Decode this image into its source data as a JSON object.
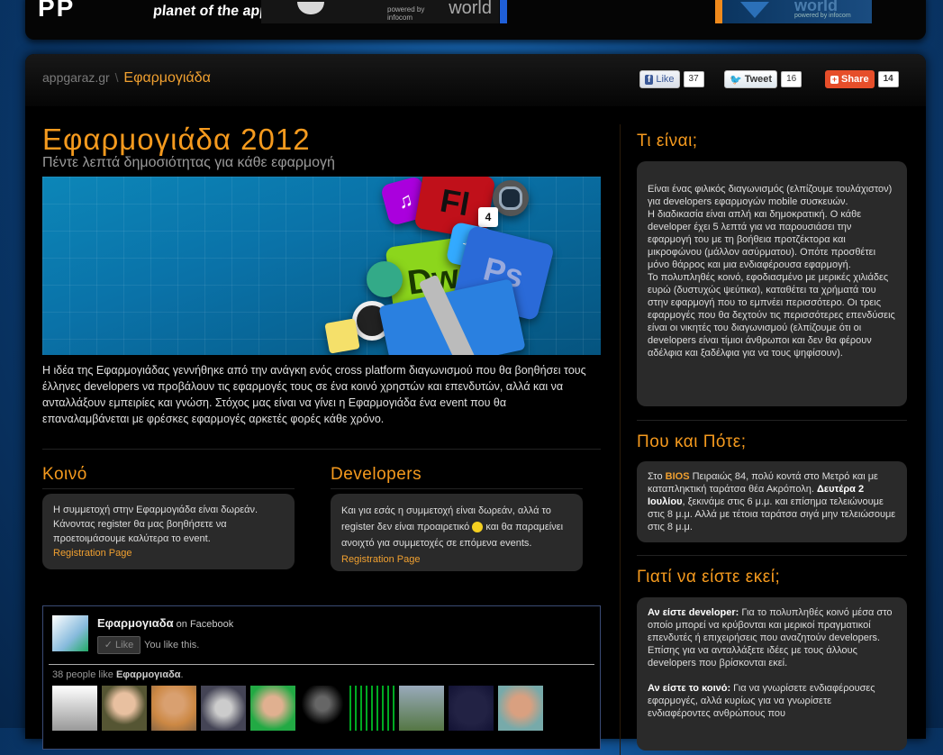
{
  "header": {
    "logo_mark": "PP",
    "logo_tagline": "planet of the apps",
    "banner1_small": "powered by\ninfocom",
    "banner1_word": "world",
    "banner2_word": "world",
    "banner2_powered": "powered by infocom"
  },
  "breadcrumb": {
    "home": "appgaraz.gr",
    "separator": "\\",
    "current": "Εφαρμογιάδα"
  },
  "social": {
    "fb_label": "Like",
    "fb_count": "37",
    "tw_label": "Tweet",
    "tw_count": "16",
    "share_label": "Share",
    "share_count": "14"
  },
  "page": {
    "title": "Εφαρμογιάδα 2012",
    "subtitle": "Πέντε λεπτά δημοσιότητας για κάθε εφαρμογή",
    "intro": "Η ιδέα της Εφαρμογιάδας γεννήθηκε από την ανάγκη ενός cross platform διαγωνισμού που θα βοηθήσει τους έλληνες developers να προβάλουν τις εφαρμογές τους σε ένα κοινό χρηστών και επενδυτών, αλλά και να ανταλλάξουν εμπειρίες και γνώση. Στόχος μας είναι να γίνει η Εφαρμογιάδα ένα event που θα επαναλαμβάνεται με φρέσκες εφαρμογές αρκετές φορές κάθε χρόνο."
  },
  "hero": {
    "tile_fl": "Fl",
    "tile_dw": "Dw",
    "tile_ps": "Ps",
    "tile_cal": "4"
  },
  "koino": {
    "heading": "Κοινό",
    "text": "Η συμμετοχή στην Εφαρμογιάδα είναι δωρεάν. Κάνοντας register θα μας βοηθήσετε να προετοιμάσουμε καλύτερα το event.",
    "link": "Registration Page"
  },
  "developers": {
    "heading": "Developers",
    "text_before": "Και για εσάς η συμμετοχή είναι δωρεάν, αλλά το register δεν είναι προαιρετικό",
    "text_after": " και θα παραμείνει ανοιχτό για συμμετοχές σε επόμενα events. ",
    "link": "Registration Page"
  },
  "fb_widget": {
    "page_name": "Εφαρμογιαδα",
    "on": " on Facebook",
    "like_btn": "✓ Like",
    "you_like": "You like this.",
    "count_text": "38 people like ",
    "count_name": "Εφαρμογιαδα",
    "count_end": "."
  },
  "sidebar": {
    "what_heading": "Τι είναι;",
    "what_text": "Είναι ένας φιλικός διαγωνισμός (ελπίζουμε τουλάχιστον) για developers εφαρμογών mobile συσκευών.\nΗ διαδικασία είναι απλή και δημοκρατική. Ο κάθε developer έχει 5 λεπτά για να παρουσιάσει την εφαρμογή του με τη βοήθεια προτζέκτορα και μικροφώνου (μάλλον ασύρματου). Οπότε προσθέτει μόνο θάρρος και μια ενδιαφέρουσα εφαρμογή.\nΤο πολυπληθές κοινό, εφοδιασμένο με μερικές χιλιάδες ευρώ (δυστυχώς ψεύτικα), καταθέτει τα χρήματά του στην εφαρμογή που το εμπνέει περισσότερο. Οι τρεις εφαρμογές που θα δεχτούν τις περισσότερες επενδύσεις είναι οι νικητές του διαγωνισμού (ελπίζουμε ότι οι developers είναι τίμιοι άνθρωποι και δεν θα φέρουν αδέλφια και ξαδέλφια για να τους ψηφίσουν).",
    "where_heading": "Που και Πότε;",
    "where_pre": "Στο ",
    "where_bios": "BIOS",
    "where_mid": " Πειραιώς 84, πολύ κοντά στο Μετρό και με καταπληκτική ταράτσα θέα Ακρόπολη. ",
    "where_date": "Δευτέρα 2 Ιουλίου",
    "where_post": ", ξεκινάμε στις 6 μ.μ. και επίσημα τελειώνουμε στις 8 μ.μ. Αλλά με τέτοια ταράτσα σιγά μην τελειώσουμε στις 8 μ.μ.",
    "why_heading": "Γιατί να είστε εκεί;",
    "why_dev_label": "Αν είστε developer:",
    "why_dev_text": " Για το πολυπληθές κοινό μέσα στο οποίο μπορεί να κρύβονται και μερικοί πραγματικοί επενδυτές ή επιχειρήσεις που αναζητούν developers. Επίσης για να ανταλλάξετε ιδέες με τους άλλους developers που βρίσκονται εκεί.",
    "why_pub_label": "Αν είστε το κοινό:",
    "why_pub_text": " Για να γνωρίσετε ενδιαφέρουσες εφαρμογές, αλλά κυρίως για να γνωρίσετε ενδιαφέροντες ανθρώπους που"
  },
  "colors": {
    "accent": "#f59a1e",
    "link": "#f0a030",
    "box_bg": "#2a2a2a"
  }
}
